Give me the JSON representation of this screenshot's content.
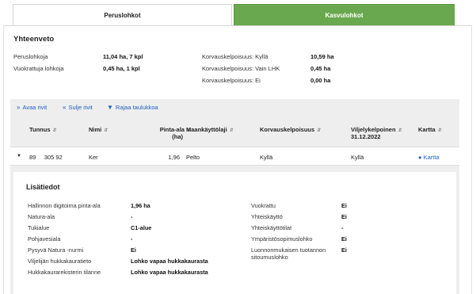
{
  "tabs": {
    "base": "Peruslohkot",
    "crop": "Kasvulohkot"
  },
  "summary": {
    "title": "Yhteenveto",
    "left": [
      {
        "label": "Peruslohkoja",
        "value": "11,04 ha, 7 kpl"
      },
      {
        "label": "Vuokrattuja lohkoja",
        "value": "0,45 ha, 1 kpl"
      }
    ],
    "right": [
      {
        "label": "Korvauskelpoisuus: Kyllä",
        "value": "10,59 ha"
      },
      {
        "label": "Korvauskelpoisuus: Vain LHK",
        "value": "0,45 ha"
      },
      {
        "label": "Korvauskelpoisuus: Ei",
        "value": "0,00 ha"
      }
    ]
  },
  "toolbar": {
    "expand": "Avaa rivit",
    "collapse": "Sulje rivit",
    "filter": "Rajaa taulukkoa"
  },
  "table": {
    "headers": {
      "id": "Tunnus",
      "name": "Nimi",
      "area_line1": "Pinta-ala",
      "area_line2": "(ha)",
      "land_use": "Maankäyttölaji",
      "eligibility": "Korvauskelpoisuus",
      "farmer_line1": "Viljelykelpoinen",
      "farmer_line2": "31.12.2022",
      "map": "Kartta"
    },
    "row": {
      "id": "89     305 92",
      "name": "Ker",
      "area": "1,96",
      "land_use": "Pelto",
      "eligibility": "Kyllä",
      "farmer": "Kyllä",
      "map": "Kartta"
    }
  },
  "details": {
    "title": "Lisätiedot",
    "left": [
      {
        "label": "Hallinnon digitoima pinta-ala",
        "value": "1,96 ha"
      },
      {
        "label": "Natura-ala",
        "value": "-"
      },
      {
        "label": "Tukialue",
        "value": "C1-alue"
      },
      {
        "label": "Pohjavesiala",
        "value": "-"
      },
      {
        "label": "Pysyvä Natura -nurmi",
        "value": "Ei"
      },
      {
        "label": "Viljelijän hukkakauratieto",
        "value": "Lohko vapaa hukkakaurasta"
      },
      {
        "label": "Hukkakaurarekisterin tilanne",
        "value": "Lohko vapaa hukkakaurasta"
      }
    ],
    "right": [
      {
        "label": "Vuokrattu",
        "value": "Ei"
      },
      {
        "label": "Yhteiskäyttö",
        "value": "Ei"
      },
      {
        "label": "Yhteiskäyttötilat",
        "value": "-"
      },
      {
        "label": "Ympäristösopimuslohko",
        "value": "Ei"
      },
      {
        "label": "Luonnonmukaisen tuotannon sitoumuslohko",
        "value": "Ei"
      }
    ]
  }
}
